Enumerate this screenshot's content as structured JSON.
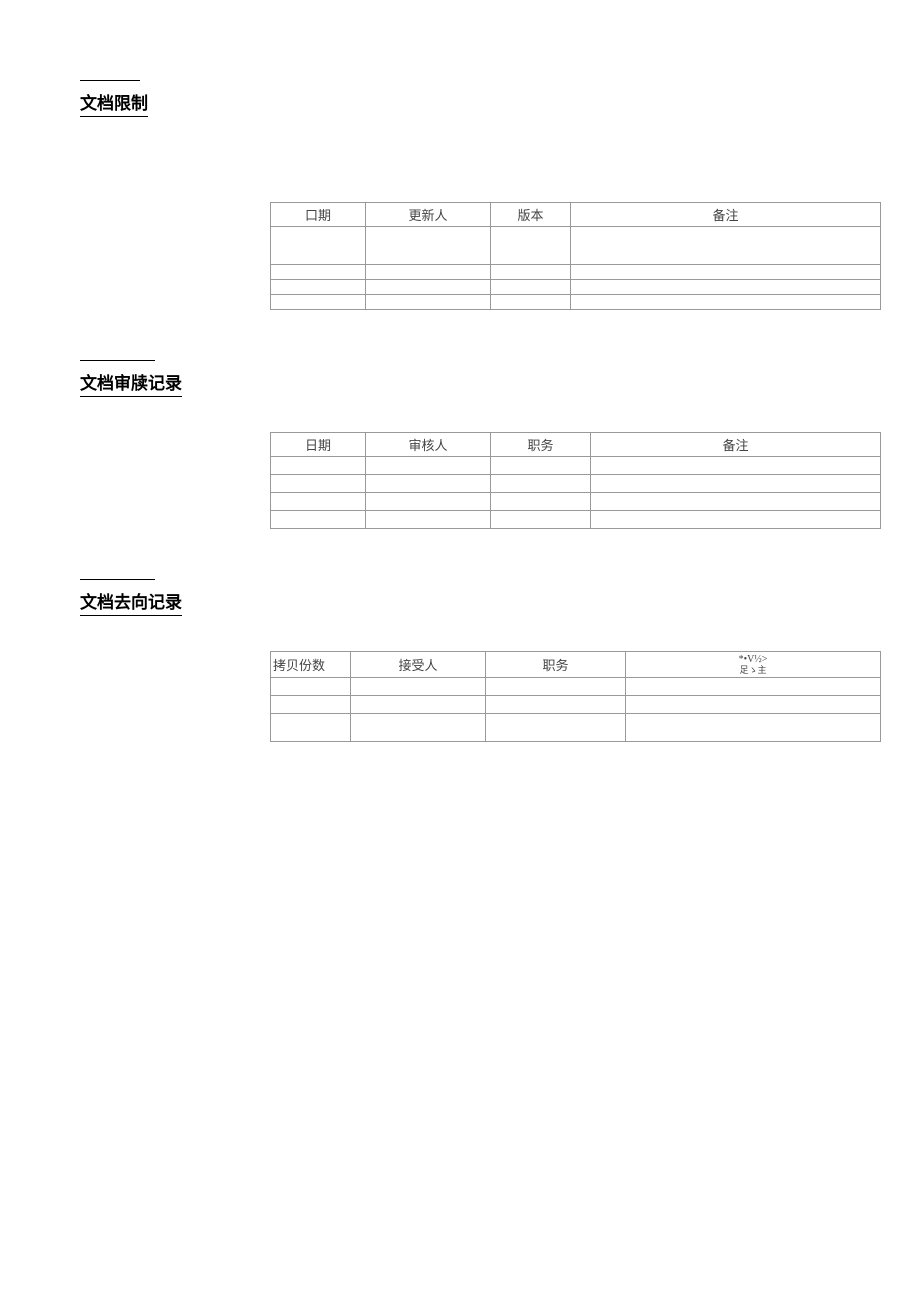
{
  "sections": {
    "restrict": {
      "title": "文档限制",
      "headers": [
        "口期",
        "更新人",
        "版本",
        "备注"
      ]
    },
    "review": {
      "title": "文档审牍记录",
      "headers": [
        "日期",
        "审核人",
        "职务",
        "备注"
      ]
    },
    "distribution": {
      "title": "文档去向记录",
      "headers": [
        "拷贝份数",
        "接受人",
        "职务"
      ],
      "headerNote1": "*•V½>",
      "headerNote2": "足ゝ主"
    }
  }
}
